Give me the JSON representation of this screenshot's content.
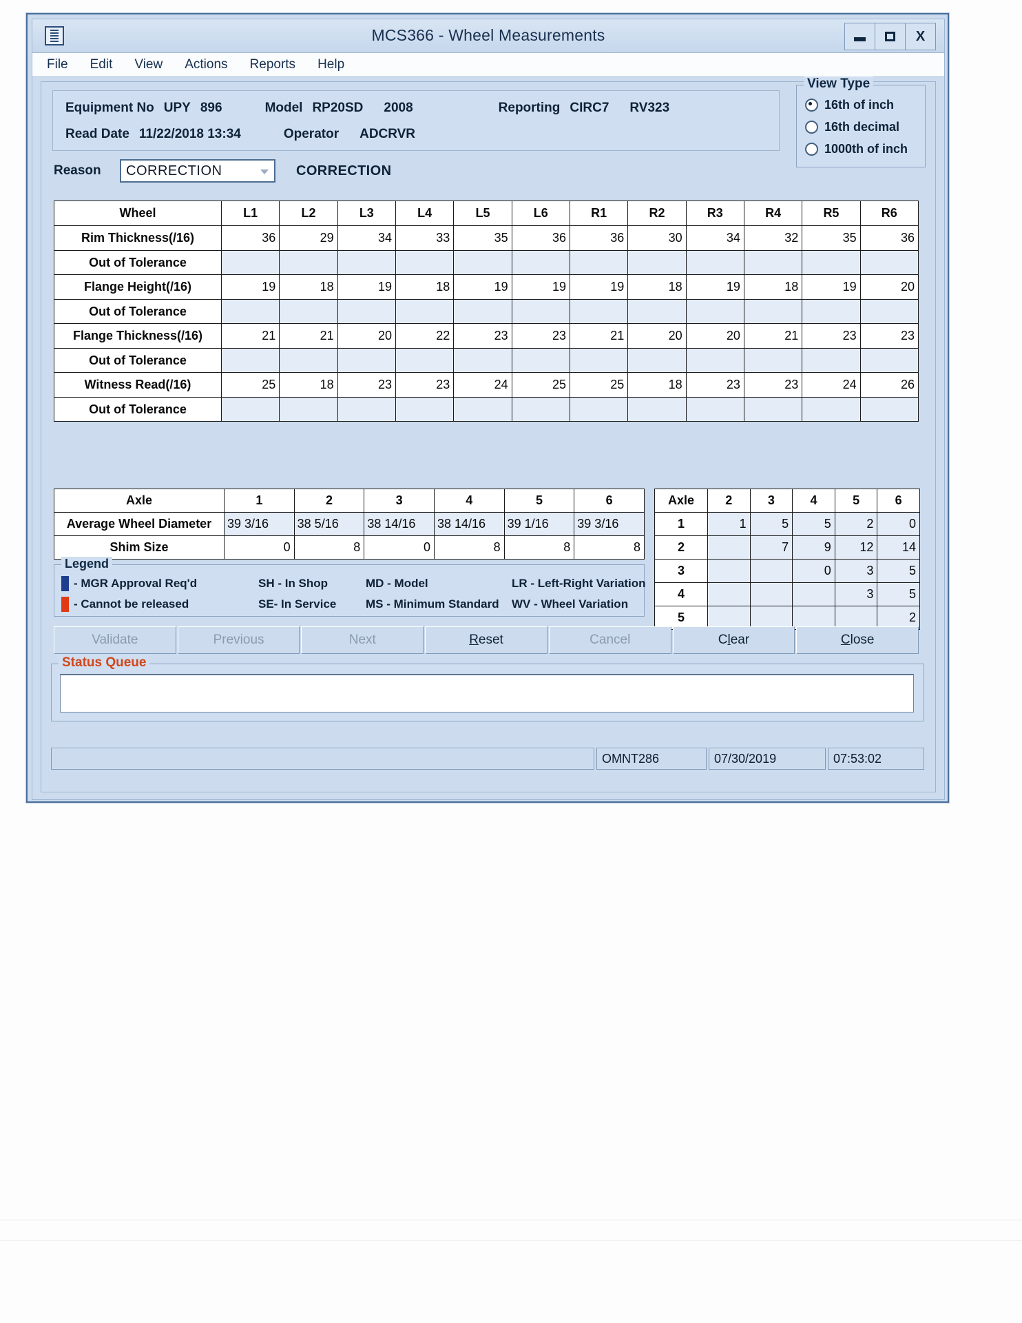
{
  "window": {
    "title": "MCS366 - Wheel Measurements",
    "icon": "application-icon",
    "controls": {
      "minimize": "minimize",
      "maximize": "maximize",
      "close": "X"
    }
  },
  "menu": {
    "items": [
      "File",
      "Edit",
      "View",
      "Actions",
      "Reports",
      "Help"
    ]
  },
  "header": {
    "equipment_label": "Equipment No",
    "equipment_initials": "UPY",
    "equipment_number": "896",
    "model_label": "Model",
    "model_value": "RP20SD",
    "model_year": "2008",
    "reporting_label": "Reporting",
    "reporting_value": "CIRC7",
    "reporting_code": "RV323",
    "read_date_label": "Read Date",
    "read_date_value": "11/22/2018 13:34",
    "operator_label": "Operator",
    "operator_value": "ADCRVR"
  },
  "view_type": {
    "title": "View Type",
    "options": [
      {
        "label": "16th of inch",
        "selected": true
      },
      {
        "label": "16th decimal",
        "selected": false
      },
      {
        "label": "1000th of inch",
        "selected": false
      }
    ]
  },
  "reason": {
    "label": "Reason",
    "selected": "CORRECTION",
    "description": "CORRECTION"
  },
  "wheel_table": {
    "corner_header": "Wheel",
    "columns": [
      "L1",
      "L2",
      "L3",
      "L4",
      "L5",
      "L6",
      "R1",
      "R2",
      "R3",
      "R4",
      "R5",
      "R6"
    ],
    "tolerance_label": "Out of Tolerance",
    "rows": [
      {
        "label": "Rim Thickness(/16)",
        "values": [
          "36",
          "29",
          "34",
          "33",
          "35",
          "36",
          "36",
          "30",
          "34",
          "32",
          "35",
          "36"
        ]
      },
      {
        "label": "Flange Height(/16)",
        "values": [
          "19",
          "18",
          "19",
          "18",
          "19",
          "19",
          "19",
          "18",
          "19",
          "18",
          "19",
          "20"
        ]
      },
      {
        "label": "Flange Thickness(/16)",
        "values": [
          "21",
          "21",
          "20",
          "22",
          "23",
          "23",
          "21",
          "20",
          "20",
          "21",
          "23",
          "23"
        ]
      },
      {
        "label": "Witness Read(/16)",
        "values": [
          "25",
          "18",
          "23",
          "23",
          "24",
          "25",
          "25",
          "18",
          "23",
          "23",
          "24",
          "26"
        ]
      }
    ],
    "tolerance_values": [
      "",
      "",
      "",
      "",
      "",
      "",
      "",
      "",
      "",
      "",
      "",
      ""
    ]
  },
  "axle_table": {
    "corner_header": "Axle",
    "columns": [
      "1",
      "2",
      "3",
      "4",
      "5",
      "6"
    ],
    "rows": [
      {
        "label": "Average Wheel Diameter",
        "values": [
          "39 3/16",
          "38 5/16",
          "38 14/16",
          "38 14/16",
          "39 1/16",
          "39 3/16"
        ]
      },
      {
        "label": "Shim Size",
        "values": [
          "0",
          "8",
          "0",
          "8",
          "8",
          "8"
        ]
      }
    ]
  },
  "variation_table": {
    "corner_header": "Axle",
    "columns": [
      "2",
      "3",
      "4",
      "5",
      "6"
    ],
    "rows": [
      {
        "label": "1",
        "values": [
          "1",
          "5",
          "5",
          "2",
          "0"
        ]
      },
      {
        "label": "2",
        "values": [
          "",
          "7",
          "9",
          "12",
          "14"
        ]
      },
      {
        "label": "3",
        "values": [
          "",
          "",
          "0",
          "3",
          "5"
        ]
      },
      {
        "label": "4",
        "values": [
          "",
          "",
          "",
          "3",
          "5"
        ]
      },
      {
        "label": "5",
        "values": [
          "",
          "",
          "",
          "",
          "2"
        ]
      }
    ]
  },
  "legend": {
    "title": "Legend",
    "blue_color": "#1d3d8f",
    "red_color": "#e03a14",
    "row1": {
      "swatch_meaning": "- MGR Approval Req'd",
      "col2": "SH - In Shop",
      "col3": "MD - Model",
      "col4": "LR - Left-Right Variation"
    },
    "row2": {
      "swatch_meaning": "- Cannot be released",
      "col2": "SE- In Service",
      "col3": "MS - Minimum Standard",
      "col4": "WV - Wheel Variation"
    }
  },
  "buttons": [
    {
      "label": "Validate",
      "disabled": true,
      "accel": ""
    },
    {
      "label": "Previous",
      "disabled": true,
      "accel": ""
    },
    {
      "label": "Next",
      "disabled": true,
      "accel": ""
    },
    {
      "label": "Reset",
      "disabled": false,
      "accel": "R"
    },
    {
      "label": "Cancel",
      "disabled": true,
      "accel": ""
    },
    {
      "label": "Clear",
      "disabled": false,
      "accel": "l"
    },
    {
      "label": "Close",
      "disabled": false,
      "accel": "C"
    }
  ],
  "status_queue": {
    "title": "Status Queue",
    "value": "",
    "title_color": "#d2471b"
  },
  "status_bar": {
    "message": "",
    "user": "OMNT286",
    "date": "07/30/2019",
    "time": "07:53:02"
  }
}
